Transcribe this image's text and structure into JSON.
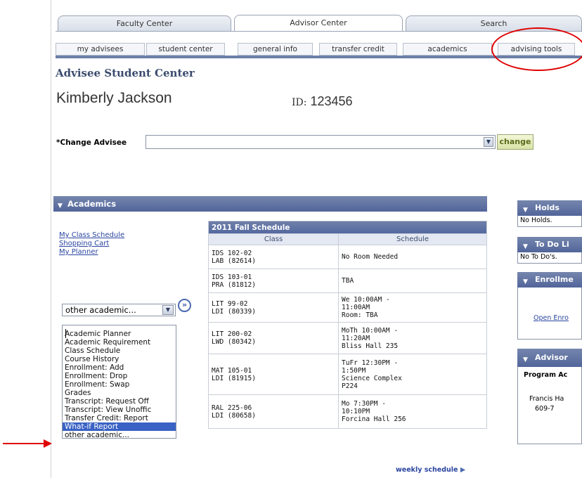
{
  "tabs": [
    "Faculty Center",
    "Advisor Center",
    "Search"
  ],
  "subtabs": [
    "my advisees",
    "student center",
    "general info",
    "transfer credit",
    "academics",
    "advising tools"
  ],
  "page_header": "Advisee Student Center",
  "student": {
    "name": "Kimberly Jackson",
    "id_label": "ID:",
    "id_value": "123456"
  },
  "change_advisee": {
    "label": "*Change Advisee",
    "value": "",
    "button": "change"
  },
  "academics": {
    "title": "Academics",
    "links": [
      "My Class Schedule",
      "Shopping Cart",
      "My Planner"
    ],
    "dropdown_selected": "other academic...",
    "dropdown_options": [
      "Academic Planner",
      "Academic Requirement",
      "Class Schedule",
      "Course History",
      "Enrollment: Add",
      "Enrollment: Drop",
      "Enrollment: Swap",
      "Grades",
      "Transcript: Request Off",
      "Transcript: View Unoffic",
      "Transfer Credit: Report",
      "What-if Report",
      "other academic..."
    ],
    "highlighted_option": "What-if Report"
  },
  "schedule": {
    "title": "2011 Fall Schedule",
    "headers": [
      "Class",
      "Schedule"
    ],
    "rows": [
      {
        "c1": "IDS 102-02",
        "c2": "LAB (82614)",
        "s": [
          "No Room Needed"
        ]
      },
      {
        "c1": "IDS 103-01",
        "c2": "PRA (81812)",
        "s": [
          "TBA"
        ]
      },
      {
        "c1": "LIT 99-02",
        "c2": "LDI (80339)",
        "s": [
          "We 10:00AM -",
          "11:00AM",
          "Room:  TBA"
        ]
      },
      {
        "c1": "LIT 200-02",
        "c2": "LWD (80342)",
        "s": [
          "MoTh 10:00AM -",
          "11:20AM",
          "Bliss Hall 235"
        ]
      },
      {
        "c1": "MAT 105-01",
        "c2": "LDI (81915)",
        "s": [
          "TuFr 12:30PM -",
          "1:50PM",
          "Science Complex",
          "P224"
        ]
      },
      {
        "c1": "RAL 225-06",
        "c2": "LDI (80658)",
        "s": [
          "Mo 7:30PM -",
          "10:10PM",
          "Forcina Hall 256"
        ]
      }
    ],
    "weekly_link": "weekly schedule"
  },
  "right": {
    "holds_title": "Holds",
    "holds_text": "No Holds.",
    "todo_title": "To Do Li",
    "todo_text": "No To Do's.",
    "enroll_title": "Enrollme",
    "enroll_link": "Open Enro",
    "advisor_title": "Advisor",
    "program_label": "Program Ac",
    "advisor_name": "Francis Ha",
    "advisor_phone": "609-7"
  },
  "annotation_color": "#e00000"
}
